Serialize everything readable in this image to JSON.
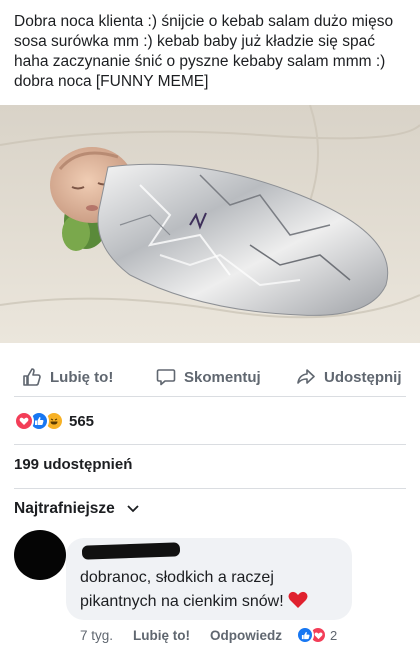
{
  "post": {
    "text": "Dobra noca klienta :) śnijcie o kebab salam dużo mięso sosa surówka mm :) kebab baby już kładzie się spać haha zaczynanie śnić o pyszne kebaby salam mmm :) dobra noca [FUNNY MEME]"
  },
  "actions": {
    "like": "Lubię to!",
    "comment": "Skomentuj",
    "share": "Udostępnij"
  },
  "reactions": {
    "count": "565",
    "types": [
      "love",
      "like",
      "haha"
    ]
  },
  "shares": {
    "label": "199 udostępnień"
  },
  "comments": {
    "sort_label": "Najtrafniejsze",
    "items": [
      {
        "text": "dobranoc, słodkich a raczej pikantnych na cienkim snów!",
        "time": "7 tyg.",
        "like_label": "Lubię to!",
        "reply_label": "Odpowiedz",
        "reaction_count": "2",
        "reaction_types": [
          "like",
          "love"
        ]
      }
    ]
  },
  "colors": {
    "like_blue": "#1877f2",
    "love_red": "#f33e58",
    "haha_yellow": "#f7b125",
    "muted_text": "#606770",
    "bubble_bg": "#f0f2f5"
  }
}
